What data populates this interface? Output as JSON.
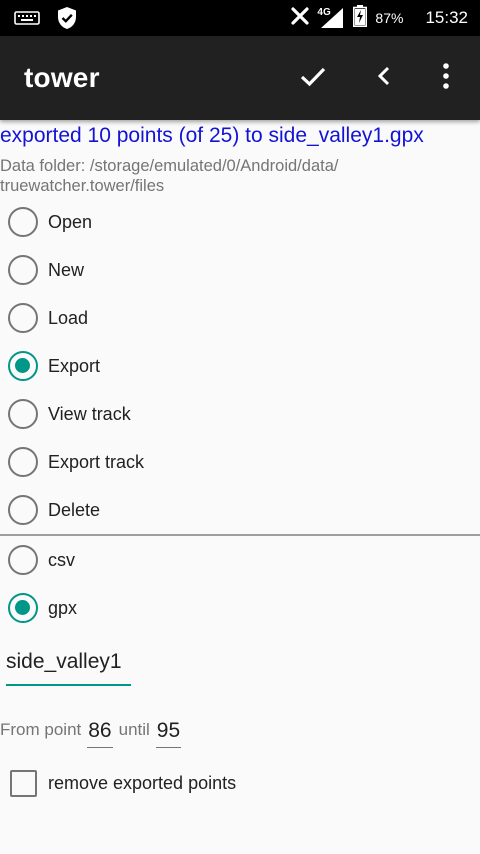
{
  "status_bar": {
    "icons": [
      "keyboard-icon",
      "shield-icon",
      "no-sim-icon",
      "signal-4g-icon",
      "battery-charging-icon"
    ],
    "network": "4G",
    "battery": "87%",
    "time": "15:32"
  },
  "app_bar": {
    "title": "tower",
    "actions": [
      "check-icon",
      "back-icon",
      "more-vert-icon"
    ]
  },
  "status_message": "exported 10 points (of 25) to side_valley1.gpx",
  "data_folder": "Data folder: /storage/emulated/0/Android/data/\ntruewatcher.tower/files",
  "actions": [
    {
      "label": "Open",
      "checked": false
    },
    {
      "label": "New",
      "checked": false
    },
    {
      "label": "Load",
      "checked": false
    },
    {
      "label": "Export",
      "checked": true
    },
    {
      "label": "View track",
      "checked": false
    },
    {
      "label": "Export track",
      "checked": false
    },
    {
      "label": "Delete",
      "checked": false
    }
  ],
  "formats": [
    {
      "label": "csv",
      "checked": false
    },
    {
      "label": "gpx",
      "checked": true
    }
  ],
  "filename": {
    "value": "side_valley1"
  },
  "range": {
    "from_label": "From point",
    "from_value": "86",
    "until_label": "until",
    "until_value": "95"
  },
  "remove_checkbox": {
    "label": "remove exported points",
    "checked": false
  },
  "colors": {
    "accent": "#009688",
    "status_text": "#1313d6",
    "app_bar": "#212121"
  }
}
